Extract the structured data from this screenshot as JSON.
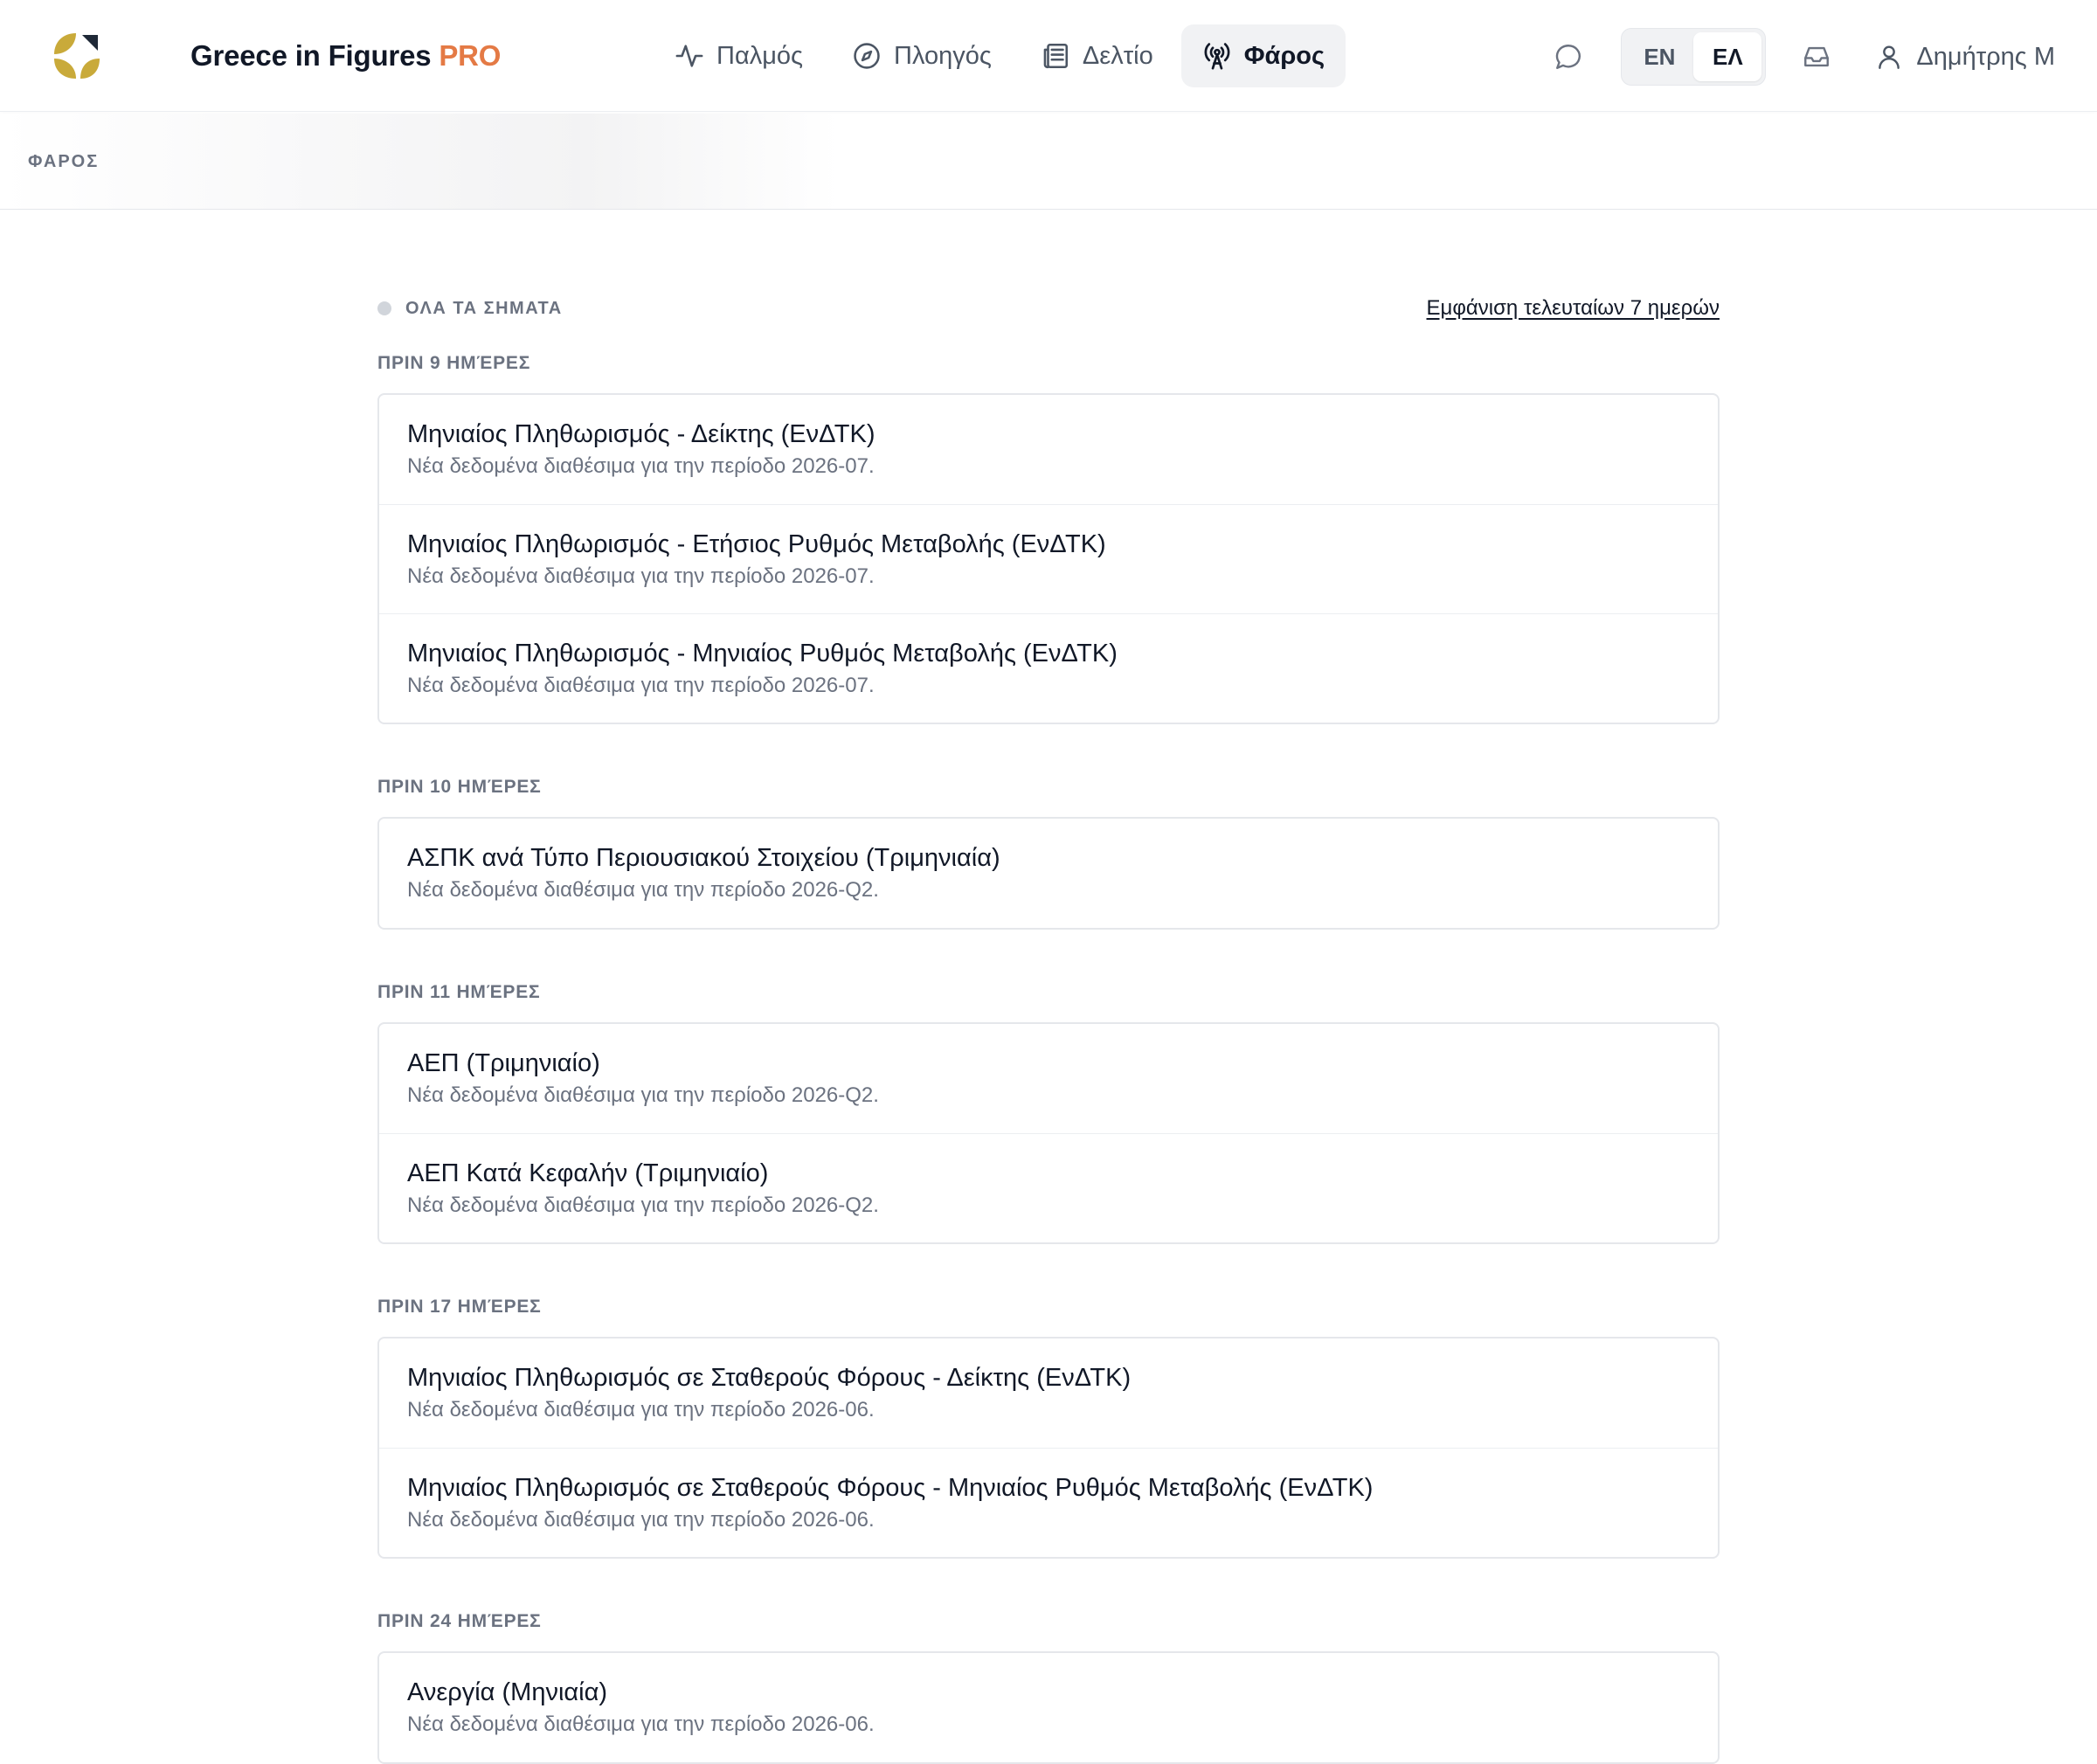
{
  "brand": {
    "name": "Greece in Figures",
    "badge": "PRO"
  },
  "nav": {
    "items": [
      {
        "label": "Παλμός",
        "icon": "pulse-icon"
      },
      {
        "label": "Πλοηγός",
        "icon": "compass-icon"
      },
      {
        "label": "Δελτίο",
        "icon": "newspaper-icon"
      },
      {
        "label": "Φάρος",
        "icon": "broadcast-icon",
        "active": true
      }
    ]
  },
  "header": {
    "chat_icon": "chat-bubble-icon",
    "languages": [
      "EN",
      "ΕΛ"
    ],
    "active_language": "ΕΛ",
    "inbox_icon": "inbox-icon",
    "user_name": "Δημήτρης Μ"
  },
  "breadcrumb": {
    "label": "ΦΑΡΟΣ"
  },
  "filter": {
    "label": "ΟΛΑ ΤΑ ΣΗΜΑΤΑ",
    "link": "Εμφάνιση τελευταίων 7 ημερών"
  },
  "groups": [
    {
      "label": "ΠΡΙΝ 9 ΗΜΈΡΕΣ",
      "items": [
        {
          "title": "Μηνιαίος Πληθωρισμός - Δείκτης (ΕνΔΤΚ)",
          "subtitle": "Νέα δεδομένα διαθέσιμα για την περίοδο 2026-07."
        },
        {
          "title": "Μηνιαίος Πληθωρισμός - Ετήσιος Ρυθμός Μεταβολής (ΕνΔΤΚ)",
          "subtitle": "Νέα δεδομένα διαθέσιμα για την περίοδο 2026-07."
        },
        {
          "title": "Μηνιαίος Πληθωρισμός - Μηνιαίος Ρυθμός Μεταβολής (ΕνΔΤΚ)",
          "subtitle": "Νέα δεδομένα διαθέσιμα για την περίοδο 2026-07."
        }
      ]
    },
    {
      "label": "ΠΡΙΝ 10 ΗΜΈΡΕΣ",
      "items": [
        {
          "title": "ΑΣΠΚ ανά Τύπο Περιουσιακού Στοιχείου (Τριμηνιαία)",
          "subtitle": "Νέα δεδομένα διαθέσιμα για την περίοδο 2026-Q2."
        }
      ]
    },
    {
      "label": "ΠΡΙΝ 11 ΗΜΈΡΕΣ",
      "items": [
        {
          "title": "ΑΕΠ (Τριμηνιαίο)",
          "subtitle": "Νέα δεδομένα διαθέσιμα για την περίοδο 2026-Q2."
        },
        {
          "title": "ΑΕΠ Κατά Κεφαλήν (Τριμηνιαίο)",
          "subtitle": "Νέα δεδομένα διαθέσιμα για την περίοδο 2026-Q2."
        }
      ]
    },
    {
      "label": "ΠΡΙΝ 17 ΗΜΈΡΕΣ",
      "items": [
        {
          "title": "Μηνιαίος Πληθωρισμός σε Σταθερούς Φόρους - Δείκτης (ΕνΔΤΚ)",
          "subtitle": "Νέα δεδομένα διαθέσιμα για την περίοδο 2026-06."
        },
        {
          "title": "Μηνιαίος Πληθωρισμός σε Σταθερούς Φόρους - Μηνιαίος Ρυθμός Μεταβολής (ΕνΔΤΚ)",
          "subtitle": "Νέα δεδομένα διαθέσιμα για την περίοδο 2026-06."
        }
      ]
    },
    {
      "label": "ΠΡΙΝ 24 ΗΜΈΡΕΣ",
      "items": [
        {
          "title": "Ανεργία (Μηνιαία)",
          "subtitle": "Νέα δεδομένα διαθέσιμα για την περίοδο 2026-06."
        }
      ]
    }
  ],
  "colors": {
    "accent": "#e47a45",
    "logo": "#c9aa3a",
    "text": "#111827",
    "muted": "#6b7280",
    "border": "#e5e7eb"
  }
}
